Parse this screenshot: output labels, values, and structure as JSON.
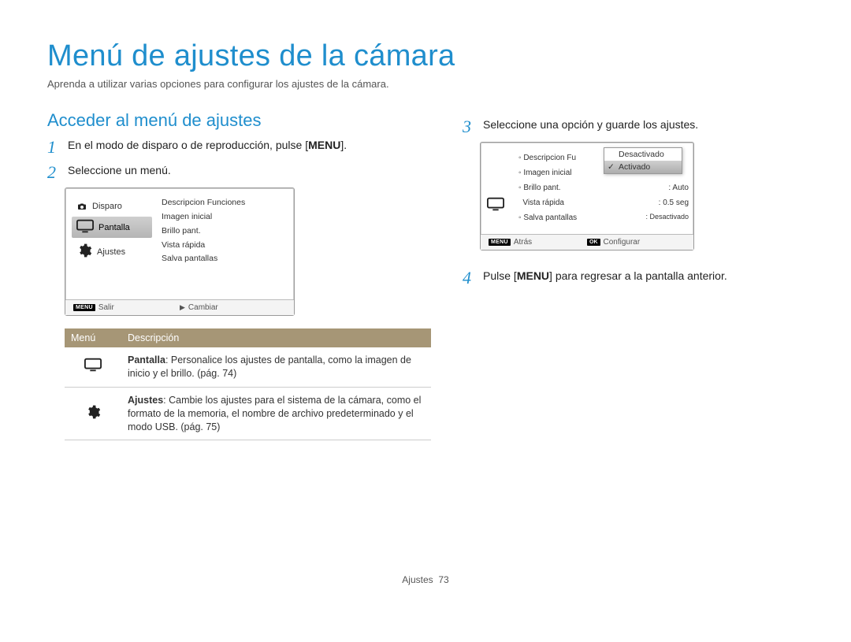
{
  "title": "Menú de ajustes de la cámara",
  "intro": "Aprenda a utilizar varias opciones para configurar los ajustes de la cámara.",
  "section_heading": "Acceder al menú de ajustes",
  "steps": {
    "s1_pre": "En el modo de disparo o de reproducción, pulse [",
    "s1_key": "MENU",
    "s1_post": "].",
    "s2": "Seleccione un menú.",
    "s3": "Seleccione una opción y guarde los ajustes.",
    "s4_pre": "Pulse [",
    "s4_key": "MENU",
    "s4_post": "] para regresar a la pantalla anterior."
  },
  "cam1": {
    "side": {
      "disparo": "Disparo",
      "pantalla": "Pantalla",
      "ajustes": "Ajustes"
    },
    "list": {
      "l0": "Descripcion Funciones",
      "l1": "Imagen inicial",
      "l2": "Brillo pant.",
      "l3": "Vista rápida",
      "l4": "Salva pantallas"
    },
    "footer": {
      "left": "Salir",
      "right": "Cambiar"
    }
  },
  "cam2": {
    "list": {
      "l0_label": "Descripcion Fu",
      "l1_label": "Imagen inicial",
      "l2_label": "Brillo pant.",
      "l2_val": ": Auto",
      "l3_label": "Vista rápida",
      "l3_val": ": 0.5 seg",
      "l4_label": "Salva pantallas",
      "l4_val": ": Desactivado"
    },
    "dropdown": {
      "opt0": "Desactivado",
      "opt1": "Activado"
    },
    "footer": {
      "left": "Atrás",
      "right": "Configurar"
    }
  },
  "table": {
    "h0": "Menú",
    "h1": "Descripción",
    "r0_bold": "Pantalla",
    "r0": ": Personalice los ajustes de pantalla, como la imagen de inicio y el brillo. (pág. 74)",
    "r1_bold": "Ajustes",
    "r1": ": Cambie los ajustes para el sistema de la cámara, como el formato de la memoria, el nombre de archivo predeterminado y el modo USB. (pág. 75)"
  },
  "footer": {
    "section": "Ajustes",
    "page": "73"
  }
}
